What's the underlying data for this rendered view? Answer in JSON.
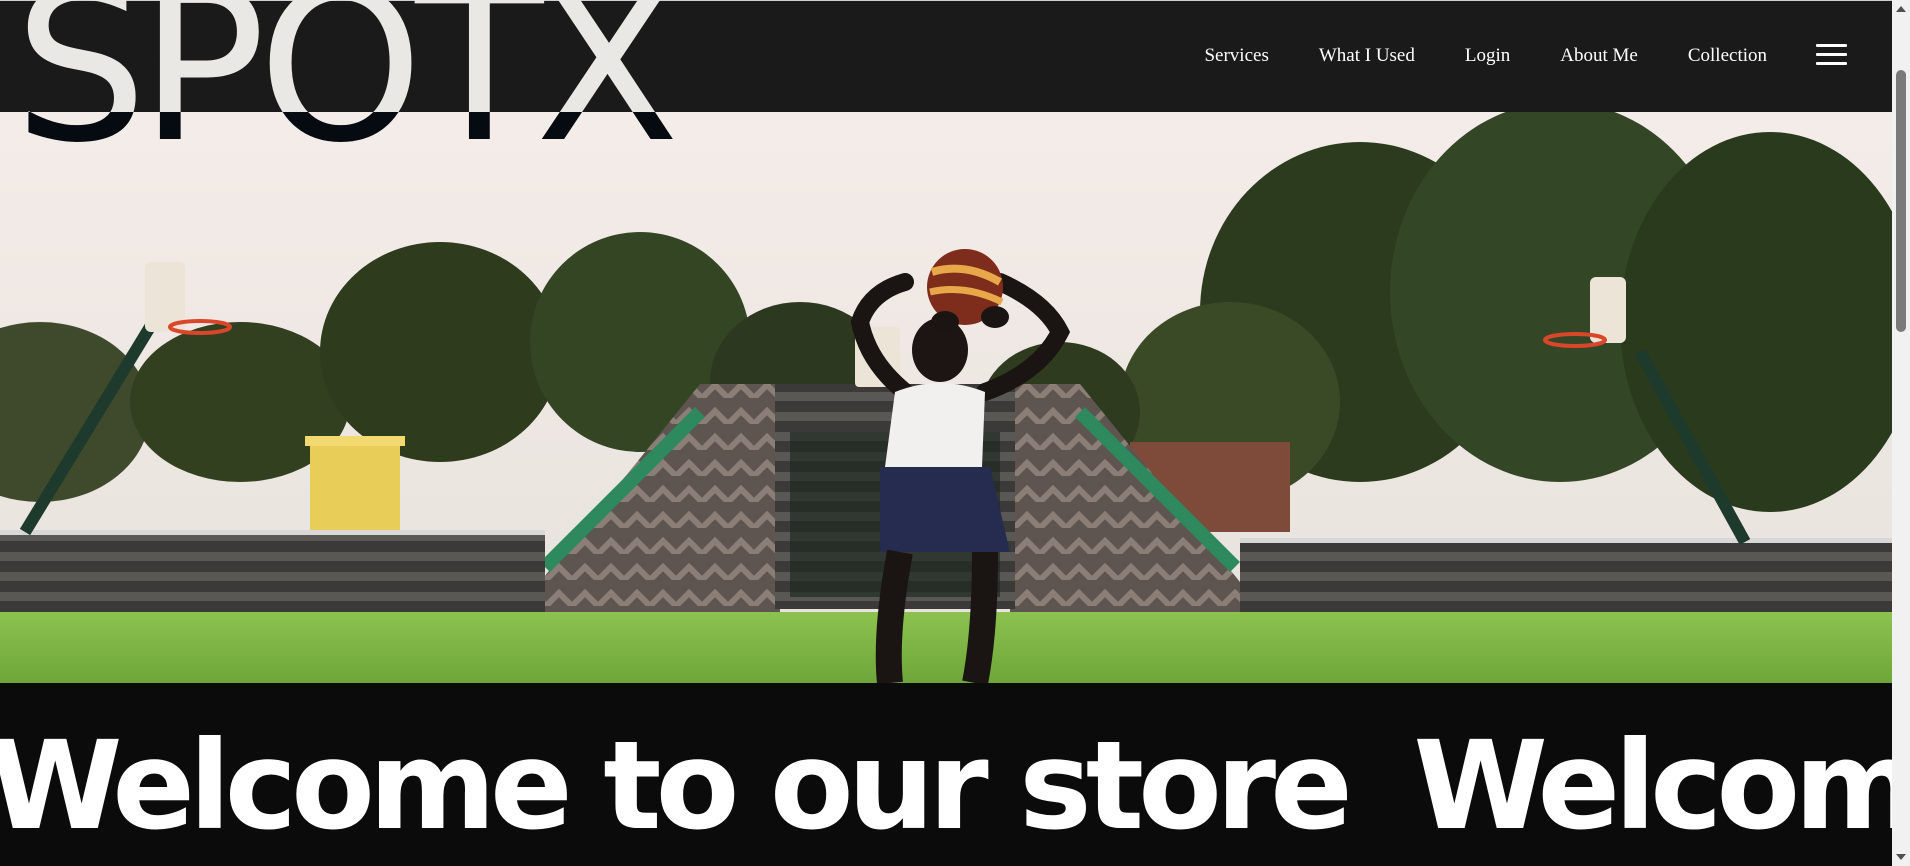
{
  "brand": {
    "logo_text": "SPOTX"
  },
  "nav": {
    "links": [
      "Services",
      "What I Used",
      "Login",
      "About Me",
      "Collection"
    ],
    "menu_icon": "hamburger-menu-icon"
  },
  "hero": {
    "media": "basketball-player-shooting-video"
  },
  "marquee": {
    "text": "Welcome to our store"
  },
  "colors": {
    "header_bg": "#1b1a1a",
    "logo_light": "#e9e8e4",
    "logo_dark": "#060b11",
    "marquee_bg": "#0b0b0b",
    "marquee_text": "#ffffff"
  }
}
